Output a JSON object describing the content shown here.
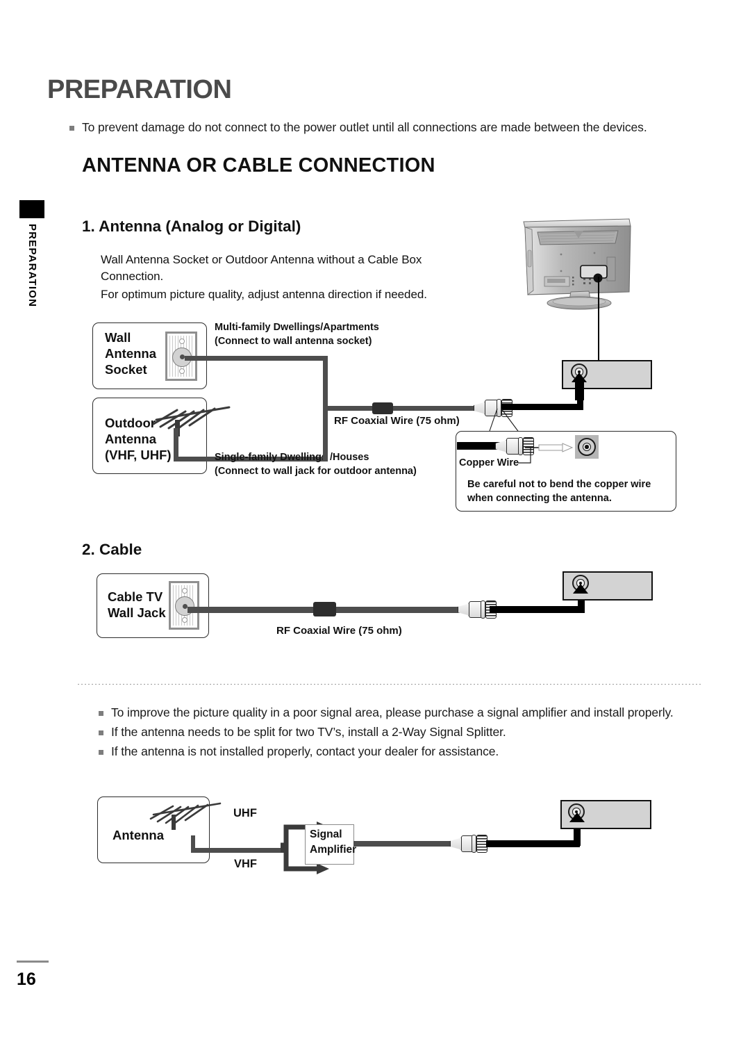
{
  "sidebar": {
    "tab_icon": "black-tab",
    "vertical_label": "PREPARATION"
  },
  "footer": {
    "page_number": "16"
  },
  "header": {
    "title": "PREPARATION",
    "top_note": "To prevent damage do not connect to the power outlet until all connections are made between the devices.",
    "section_title": "ANTENNA OR CABLE CONNECTION"
  },
  "section1": {
    "heading": "1. Antenna (Analog or Digital)",
    "line1": "Wall Antenna Socket or Outdoor Antenna without a Cable Box",
    "line2": "Connection.",
    "line3": "For optimum picture quality, adjust antenna direction if needed.",
    "wall_socket_label": "Wall\nAntenna\nSocket",
    "outdoor_label": "Outdoor\nAntenna\n(VHF, UHF)",
    "multi_family_note": "Multi-family Dwellings/Apartments\n(Connect to wall antenna socket)",
    "single_family_note": "Single-family Dwellings /Houses\n(Connect to wall jack for outdoor antenna)",
    "coax_label": "RF Coaxial Wire (75 ohm)",
    "copper_wire_label": "Copper Wire",
    "warning": "Be careful not to bend the copper wire\nwhen connecting the antenna."
  },
  "section2": {
    "heading": "2. Cable",
    "wall_jack_label": "Cable TV\nWall Jack",
    "coax_label": "RF Coaxial Wire (75 ohm)"
  },
  "tips": {
    "items": [
      "To improve the picture quality in a poor signal area, please purchase a signal amplifier and install properly.",
      "If the antenna needs to be split for two TV’s, install a 2-Way Signal Splitter.",
      "If the antenna is not installed properly, contact your dealer for assistance."
    ]
  },
  "amplifier_diagram": {
    "antenna_label": "Antenna",
    "uhf_label": "UHF",
    "vhf_label": "VHF",
    "amplifier_label": "Signal\nAmplifier"
  },
  "colors": {
    "heading_gray": "#4a4a4a",
    "bullet_gray": "#7d7d7d",
    "cable_gray": "#4d4d4d",
    "cable_black": "#000000",
    "panel_gray": "#d3d3d3"
  }
}
